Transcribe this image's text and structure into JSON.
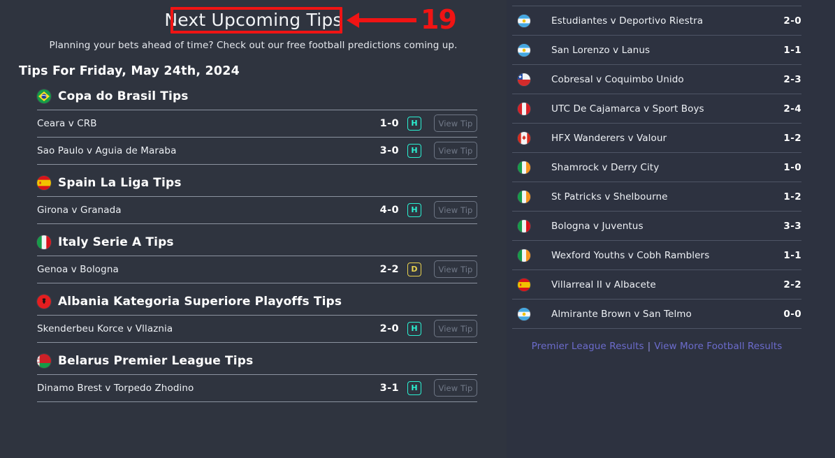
{
  "hero": {
    "title": "Next Upcoming Tips",
    "subtitle": "Planning your bets ahead of time? Check out our free football predictions coming up.",
    "date_heading": "Tips For Friday, May 24th, 2024"
  },
  "annotation": {
    "number": "19",
    "color": "#f01414"
  },
  "colors": {
    "page_background": "#2f343f",
    "panel_background": "#2d3240",
    "outcome_home": "#2bf0d2",
    "outcome_draw": "#e8d14f",
    "link": "#6c6ccd",
    "divider_left": "#8c93a0",
    "divider_right": "#4e5565"
  },
  "view_tip_label": "View Tip",
  "leagues": [
    {
      "name": "Copa do Brasil Tips",
      "flag": "brazil-flag-icon",
      "tips": [
        {
          "match": "Ceara v CRB",
          "score": "1-0",
          "outcome": "H",
          "button": "View Tip"
        },
        {
          "match": "Sao Paulo v Aguia de Maraba",
          "score": "3-0",
          "outcome": "H",
          "button": "View Tip"
        }
      ]
    },
    {
      "name": "Spain La Liga Tips",
      "flag": "spain-flag-icon",
      "tips": [
        {
          "match": "Girona v Granada",
          "score": "4-0",
          "outcome": "H",
          "button": "View Tip"
        }
      ]
    },
    {
      "name": "Italy Serie A Tips",
      "flag": "italy-flag-icon",
      "tips": [
        {
          "match": "Genoa v Bologna",
          "score": "2-2",
          "outcome": "D",
          "button": "View Tip"
        }
      ]
    },
    {
      "name": "Albania Kategoria Superiore Playoffs Tips",
      "flag": "albania-flag-icon",
      "tips": [
        {
          "match": "Skenderbeu Korce v Vllaznia",
          "score": "2-0",
          "outcome": "H",
          "button": "View Tip"
        }
      ]
    },
    {
      "name": "Belarus Premier League Tips",
      "flag": "belarus-flag-icon",
      "tips": [
        {
          "match": "Dinamo Brest v Torpedo Zhodino",
          "score": "3-1",
          "outcome": "H",
          "button": "View Tip"
        }
      ]
    }
  ],
  "results": {
    "rows": [
      {
        "match": "Estudiantes v Deportivo Riestra",
        "score": "2-0",
        "flag": "argentina-flag-icon"
      },
      {
        "match": "San Lorenzo v Lanus",
        "score": "1-1",
        "flag": "argentina-flag-icon"
      },
      {
        "match": "Cobresal v Coquimbo Unido",
        "score": "2-3",
        "flag": "chile-flag-icon"
      },
      {
        "match": "UTC De Cajamarca v Sport Boys",
        "score": "2-4",
        "flag": "peru-flag-icon"
      },
      {
        "match": "HFX Wanderers v Valour",
        "score": "1-2",
        "flag": "canada-flag-icon"
      },
      {
        "match": "Shamrock v Derry City",
        "score": "1-0",
        "flag": "ireland-flag-icon"
      },
      {
        "match": "St Patricks v Shelbourne",
        "score": "1-2",
        "flag": "ireland-flag-icon"
      },
      {
        "match": "Bologna v Juventus",
        "score": "3-3",
        "flag": "italy-flag-icon"
      },
      {
        "match": "Wexford Youths v Cobh Ramblers",
        "score": "1-1",
        "flag": "ireland-flag-icon"
      },
      {
        "match": "Villarreal II v Albacete",
        "score": "2-2",
        "flag": "spain-flag-icon"
      },
      {
        "match": "Almirante Brown v San Telmo",
        "score": "0-0",
        "flag": "argentina-flag-icon"
      }
    ],
    "footer_links": [
      {
        "label": "Premier League Results"
      },
      {
        "label": "View More Football Results"
      }
    ],
    "footer_separator": "|"
  }
}
